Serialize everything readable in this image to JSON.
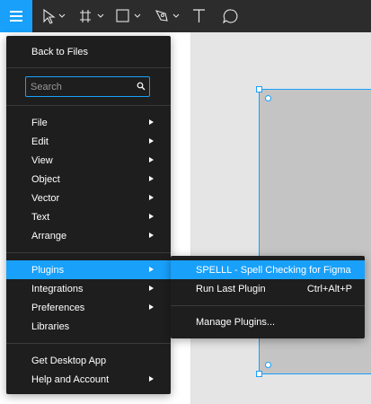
{
  "toolbar": {
    "icons": [
      "menu-icon",
      "move-tool-icon",
      "frame-tool-icon",
      "rectangle-tool-icon",
      "pen-tool-icon",
      "text-tool-icon",
      "comment-tool-icon"
    ],
    "accent": "#18a0fb",
    "background": "#2c2c2c"
  },
  "menu": {
    "back_to_files": "Back to Files",
    "search_placeholder": "Search",
    "items_group1": [
      {
        "label": "File"
      },
      {
        "label": "Edit"
      },
      {
        "label": "View"
      },
      {
        "label": "Object"
      },
      {
        "label": "Vector"
      },
      {
        "label": "Text"
      },
      {
        "label": "Arrange"
      }
    ],
    "items_group2": [
      {
        "label": "Plugins"
      },
      {
        "label": "Integrations"
      },
      {
        "label": "Preferences"
      },
      {
        "label": "Libraries"
      }
    ],
    "items_group3": [
      {
        "label": "Get Desktop App"
      },
      {
        "label": "Help and Account"
      }
    ]
  },
  "plugins_submenu": {
    "spell_plugin": "SPELLL - Spell Checking for Figma",
    "run_last": "Run Last Plugin",
    "run_last_shortcut": "Ctrl+Alt+P",
    "manage": "Manage Plugins..."
  }
}
